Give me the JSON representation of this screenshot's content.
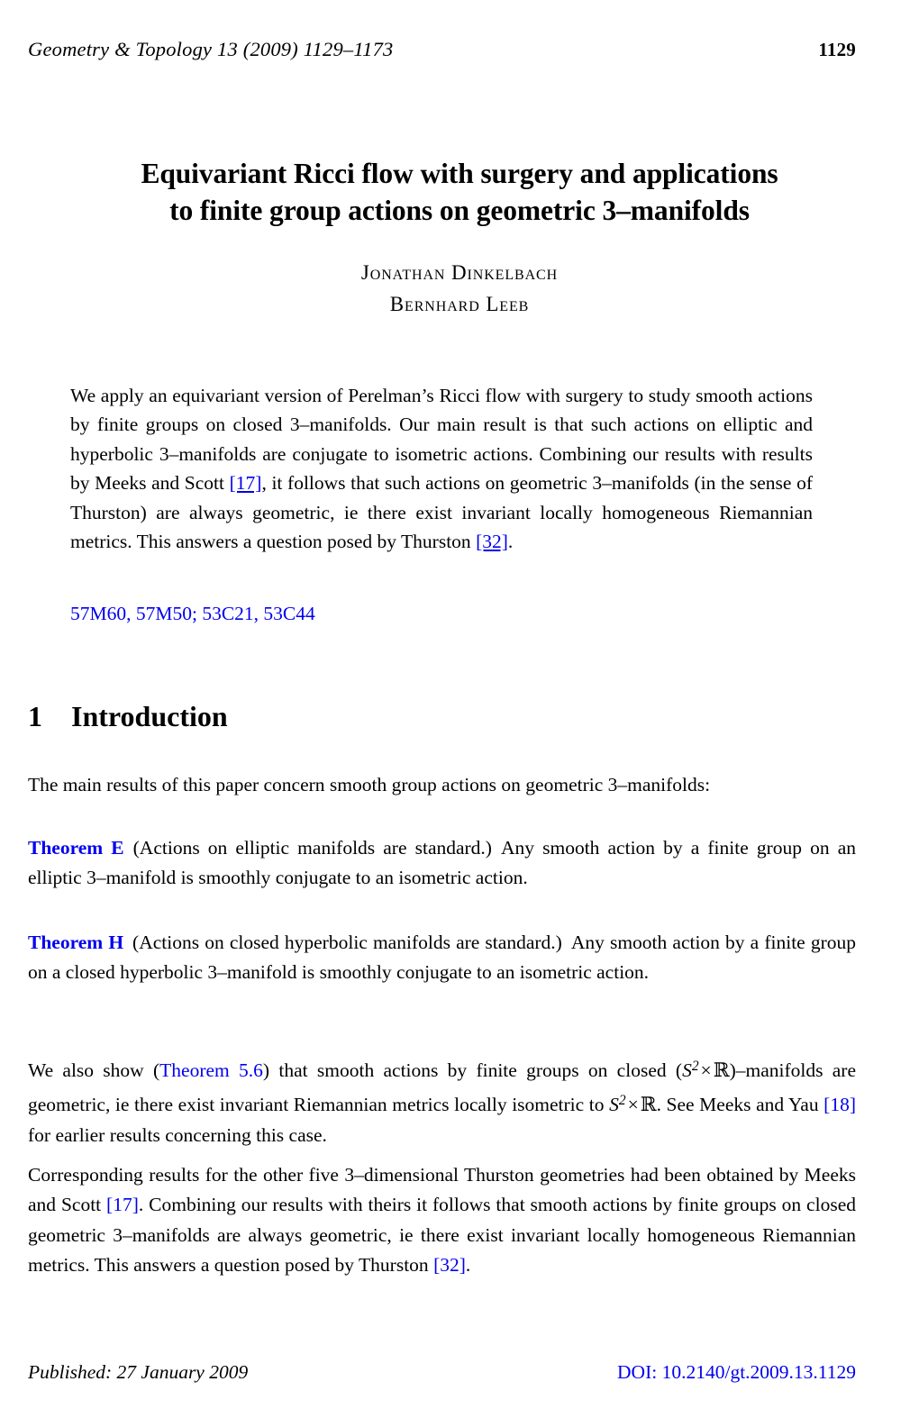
{
  "header": {
    "journal": "Geometry & Topology 13 (2009) 1129–1173",
    "page_number": "1129"
  },
  "title": {
    "line1": "Equivariant Ricci flow with surgery and applications",
    "line2": "to finite group actions on geometric 3–manifolds"
  },
  "authors": [
    {
      "name": "Jonathan Dinkelbach"
    },
    {
      "name": "Bernhard Leeb"
    }
  ],
  "abstract": {
    "part1": "We apply an equivariant version of Perelman’s Ricci flow with surgery to study smooth actions by finite groups on closed 3–manifolds. Our main result is that such actions on elliptic and hyperbolic 3–manifolds are conjugate to isometric actions. Combining our results with results by Meeks and Scott ",
    "ref1": "[17]",
    "part2": ", it follows that such actions on geometric 3–manifolds (in the sense of Thurston) are always geometric, ie there exist invariant locally homogeneous Riemannian metrics. This answers a question posed by Thurston ",
    "ref2": "[32]",
    "part3": "."
  },
  "msc": "57M60, 57M50; 53C21, 53C44",
  "section": {
    "number": "1",
    "title": "Introduction"
  },
  "intro_paragraph": "The main results of this paper concern smooth group actions on geometric 3–manifolds:",
  "theorems": [
    {
      "name": "Theorem E",
      "parenthetical": "(Actions on elliptic manifolds are standard.)",
      "statement": "Any smooth action by a finite group on an elliptic 3–manifold is smoothly conjugate to an isometric action."
    },
    {
      "name": "Theorem H",
      "parenthetical": "(Actions on closed hyperbolic manifolds are standard.)",
      "statement": "Any smooth action by a finite group on a closed hyperbolic 3–manifold is smoothly conjugate to an isometric action."
    }
  ],
  "paragraph_sr": {
    "p1": "We also show (",
    "link1": "Theorem 5.6",
    "p2": ") that smooth actions by finite groups on closed (",
    "math1_S": "S",
    "math1_sup": "2",
    "math1_times": "×",
    "math1_R": "ℝ",
    "p3": ")–manifolds are geometric, ie there exist invariant Riemannian metrics locally isometric to ",
    "math2_S": "S",
    "math2_sup": "2",
    "math2_times": "×",
    "math2_R": "ℝ",
    "p4": ". See Meeks and Yau ",
    "link2": "[18]",
    "p5": " for earlier results concerning this case."
  },
  "paragraph_corresponding": {
    "p1": "Corresponding results for the other five 3–dimensional Thurston geometries had been obtained by Meeks and Scott ",
    "link1": "[17]",
    "p2": ". Combining our results with theirs it follows that smooth actions by finite groups on closed geometric 3–manifolds are always geometric, ie there exist invariant locally homogeneous Riemannian metrics. This answers a question posed by Thurston ",
    "link2": "[32]",
    "p3": "."
  },
  "footer": {
    "published": "Published: 27 January 2009",
    "doi": "DOI: 10.2140/gt.2009.13.1129"
  },
  "colors": {
    "link_blue": "#0000EE",
    "text_black": "#000000",
    "page_background": "#ffffff"
  }
}
